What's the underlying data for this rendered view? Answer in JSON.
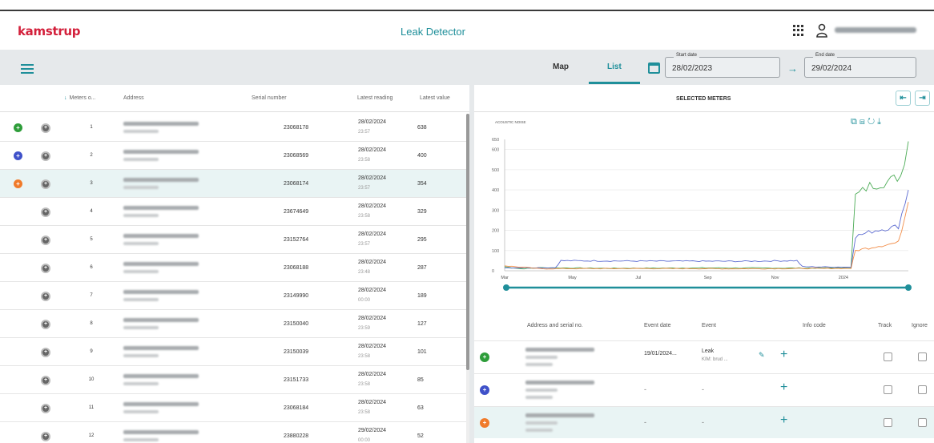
{
  "header": {
    "logo": "kamstrup",
    "app_title": "Leak Detector"
  },
  "toolbar": {
    "tabs": [
      {
        "label": "Map"
      },
      {
        "label": "List"
      }
    ],
    "start_date": {
      "label": "Start date",
      "value": "28/02/2023"
    },
    "end_date": {
      "label": "End date",
      "value": "29/02/2024"
    }
  },
  "meters_table": {
    "columns": [
      "Meters o...",
      "Address",
      "Serial number",
      "Latest reading",
      "Latest value"
    ],
    "rows": [
      {
        "rank": "1",
        "serial": "23068178",
        "date": "28/02/2024",
        "time": "23:57",
        "value": "638",
        "marker": "green"
      },
      {
        "rank": "2",
        "serial": "23068569",
        "date": "28/02/2024",
        "time": "23:58",
        "value": "400",
        "marker": "blue"
      },
      {
        "rank": "3",
        "serial": "23068174",
        "date": "28/02/2024",
        "time": "23:57",
        "value": "354",
        "marker": "orange"
      },
      {
        "rank": "4",
        "serial": "23674649",
        "date": "28/02/2024",
        "time": "23:58",
        "value": "329",
        "marker": ""
      },
      {
        "rank": "5",
        "serial": "23152764",
        "date": "28/02/2024",
        "time": "23:57",
        "value": "295",
        "marker": ""
      },
      {
        "rank": "6",
        "serial": "23068188",
        "date": "28/02/2024",
        "time": "23:48",
        "value": "287",
        "marker": ""
      },
      {
        "rank": "7",
        "serial": "23149990",
        "date": "28/02/2024",
        "time": "00:00",
        "value": "189",
        "marker": ""
      },
      {
        "rank": "8",
        "serial": "23150040",
        "date": "28/02/2024",
        "time": "23:59",
        "value": "127",
        "marker": ""
      },
      {
        "rank": "9",
        "serial": "23150039",
        "date": "28/02/2024",
        "time": "23:58",
        "value": "101",
        "marker": ""
      },
      {
        "rank": "10",
        "serial": "23151733",
        "date": "28/02/2024",
        "time": "23:58",
        "value": "85",
        "marker": ""
      },
      {
        "rank": "11",
        "serial": "23068184",
        "date": "28/02/2024",
        "time": "23:58",
        "value": "63",
        "marker": ""
      },
      {
        "rank": "12",
        "serial": "23880228",
        "date": "29/02/2024",
        "time": "00:00",
        "value": "52",
        "marker": ""
      }
    ]
  },
  "selected_meters": {
    "title": "SELECTED METERS"
  },
  "colors": {
    "accent": "#1f8f9a",
    "green": "#2e9d3a",
    "blue": "#3f51c9",
    "orange": "#f07a2a",
    "logo": "#d3203b"
  },
  "chart_data": {
    "type": "line",
    "ylabel": "ACOUSTIC NOISE",
    "y_ticks": [
      "0",
      "100",
      "200",
      "300",
      "400",
      "500",
      "600",
      "650"
    ],
    "x_ticks": [
      "Mar",
      "May",
      "Jul",
      "Sep",
      "Nov",
      "2024"
    ],
    "ylim": [
      0,
      650
    ],
    "x_range": [
      "2023-02-28",
      "2024-02-29"
    ],
    "series": [
      {
        "color": "green",
        "points": [
          [
            "2023-02-28",
            20
          ],
          [
            "2023-03-15",
            10
          ],
          [
            "2023-04-01",
            15
          ],
          [
            "2023-06-01",
            12
          ],
          [
            "2023-09-01",
            14
          ],
          [
            "2023-12-01",
            13
          ],
          [
            "2024-01-08",
            15
          ],
          [
            "2024-01-12",
            370
          ],
          [
            "2024-01-25",
            420
          ],
          [
            "2024-02-10",
            440
          ],
          [
            "2024-02-22",
            470
          ],
          [
            "2024-02-29",
            640
          ]
        ]
      },
      {
        "color": "blue",
        "points": [
          [
            "2023-02-28",
            15
          ],
          [
            "2023-04-15",
            15
          ],
          [
            "2023-04-20",
            50
          ],
          [
            "2023-07-01",
            48
          ],
          [
            "2023-10-01",
            47
          ],
          [
            "2023-11-20",
            50
          ],
          [
            "2023-11-25",
            20
          ],
          [
            "2024-01-08",
            18
          ],
          [
            "2024-01-12",
            170
          ],
          [
            "2024-01-30",
            200
          ],
          [
            "2024-02-20",
            220
          ],
          [
            "2024-02-29",
            400
          ]
        ]
      },
      {
        "color": "orange",
        "points": [
          [
            "2023-02-28",
            25
          ],
          [
            "2023-03-10",
            20
          ],
          [
            "2023-04-01",
            10
          ],
          [
            "2023-07-01",
            11
          ],
          [
            "2023-10-01",
            10
          ],
          [
            "2024-01-08",
            12
          ],
          [
            "2024-01-12",
            100
          ],
          [
            "2024-01-30",
            120
          ],
          [
            "2024-02-20",
            140
          ],
          [
            "2024-02-29",
            340
          ]
        ]
      }
    ]
  },
  "events_table": {
    "columns": [
      "Address and serial no.",
      "Event date",
      "Event",
      "Info code",
      "Track",
      "Ignore"
    ],
    "rows": [
      {
        "marker": "green",
        "event_date": "19/01/2024...",
        "event": "Leak",
        "event_sub": "KIM: brud ..."
      },
      {
        "marker": "blue",
        "event_date": "-",
        "event": "-",
        "event_sub": ""
      },
      {
        "marker": "orange",
        "event_date": "-",
        "event": "-",
        "event_sub": ""
      }
    ]
  }
}
